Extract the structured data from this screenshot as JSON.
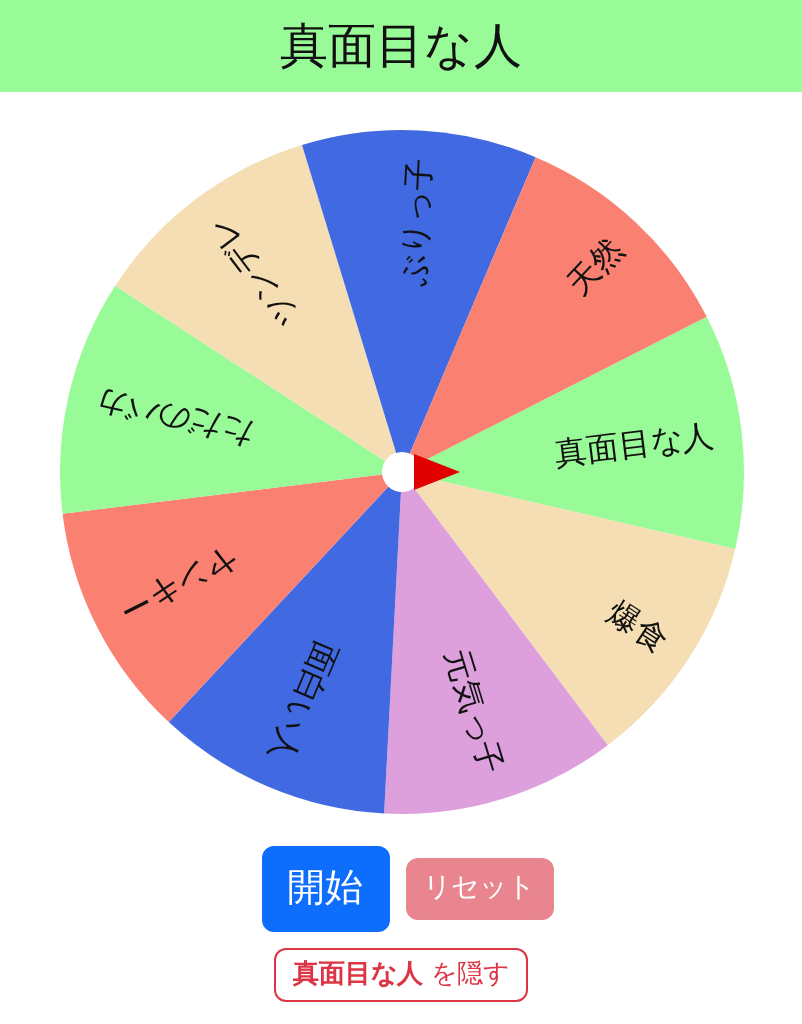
{
  "title": "真面目な人",
  "wheel": {
    "segments": [
      {
        "label": "真面目な人",
        "color": "#98fb98"
      },
      {
        "label": "爆食",
        "color": "#f5deb3"
      },
      {
        "label": "元気っ子",
        "color": "#dda0dd"
      },
      {
        "label": "面白い人",
        "color": "#4169e1"
      },
      {
        "label": "ヤンキー",
        "color": "#fa8072"
      },
      {
        "label": "ただのバカ",
        "color": "#98fb98"
      },
      {
        "label": "ツンデレ",
        "color": "#f5deb3"
      },
      {
        "label": "ぶりっ子",
        "color": "#4169e1"
      },
      {
        "label": "天然",
        "color": "#fa8072"
      }
    ]
  },
  "buttons": {
    "start": {
      "label": "開始",
      "disabled": false
    },
    "reset": {
      "label": "リセット",
      "disabled": true
    },
    "hide": {
      "label": "**真面目な人** を隠す"
    }
  }
}
